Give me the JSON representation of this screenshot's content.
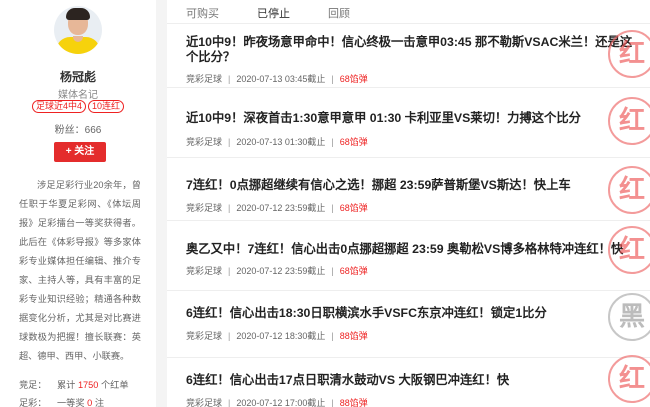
{
  "profile": {
    "name": "杨冠彪",
    "role": "媒体名记",
    "badges": [
      "足球近4中4",
      "10连红"
    ],
    "fans_label": "粉丝：",
    "fans_count": "666",
    "follow_label": "+ 关注",
    "bio": "涉足足彩行业20余年，曾任职于华夏足彩网、《体坛周报》足彩擂台一等奖获得者。此后在《体彩导报》等多家体彩专业媒体担任编辑、推介专家、主持人等，具有丰富的足彩专业知识经验；精通各种数据变化分析，尤其是对比赛进球数极为把握！擅长联赛：英超、德甲、西甲、小联赛。",
    "stats": [
      {
        "label": "竞足：",
        "prefix": "累计",
        "value": "1750",
        "suffix": "个红单"
      },
      {
        "label": "足彩：",
        "prefix": "一等奖",
        "value": "0",
        "suffix": "注"
      }
    ]
  },
  "tabs": [
    "可购买",
    "已停止",
    "回顾"
  ],
  "active_tab": "已停止",
  "items": [
    {
      "title": "近10中9！昨夜场意甲命中！信心终极一击意甲03:45 那不勒斯VSAC米兰！还是这个比分？",
      "category": "竞彩足球",
      "date": "2020-07-13 03:45截止",
      "price": "68馅弹",
      "stamp": "红"
    },
    {
      "title": "近10中9！深夜首击1:30意甲意甲 01:30 卡利亚里VS莱切！力搏这个比分",
      "category": "竞彩足球",
      "date": "2020-07-13 01:30截止",
      "price": "68馅弹",
      "stamp": "红"
    },
    {
      "title": "7连红！0点挪超继续有信心之选！挪超 23:59萨普斯堡VS斯达！快上车",
      "category": "竞彩足球",
      "date": "2020-07-12 23:59截止",
      "price": "68馅弹",
      "stamp": "红"
    },
    {
      "title": "奥乙又中！7连红！信心出击0点挪超挪超 23:59 奥勒松VS博多格林特冲连红！快",
      "category": "竞彩足球",
      "date": "2020-07-12 23:59截止",
      "price": "68馅弹",
      "stamp": "红"
    },
    {
      "title": "6连红！信心出击18:30日职横滨水手VSFC东京冲连红！锁定1比分",
      "category": "竞彩足球",
      "date": "2020-07-12 18:30截止",
      "price": "88馅弹",
      "stamp": "黑"
    },
    {
      "title": "6连红！信心出击17点日职清水鼓动VS 大阪钢巴冲连红！快",
      "category": "竞彩足球",
      "date": "2020-07-12 17:00截止",
      "price": "88馅弹",
      "stamp": "红"
    }
  ]
}
